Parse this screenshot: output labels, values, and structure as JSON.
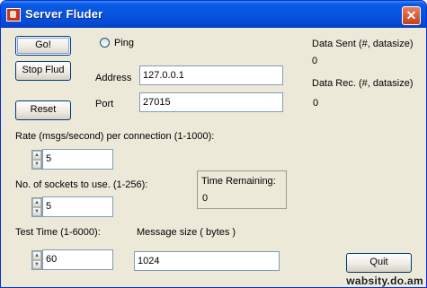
{
  "window": {
    "title": "Server Fluder",
    "close_glyph": "✕"
  },
  "buttons": {
    "go": "Go!",
    "stop": "Stop Flud",
    "reset": "Reset",
    "quit": "Quit"
  },
  "ping": {
    "label": "Ping",
    "checked": false
  },
  "address": {
    "label": "Address",
    "value": "127.0.0.1"
  },
  "port": {
    "label": "Port",
    "value": "27015"
  },
  "stats": {
    "sent_label": "Data Sent (#, datasize)",
    "sent_value": "0",
    "rec_label": "Data Rec. (#, datasize)",
    "rec_value": "0"
  },
  "rate": {
    "label": "Rate (msgs/second) per connection (1-1000):",
    "value": "5"
  },
  "sockets": {
    "label": "No. of sockets to use. (1-256):",
    "value": "5"
  },
  "time_remaining": {
    "label": "Time Remaining:",
    "value": "0"
  },
  "test_time": {
    "label": "Test Time (1-6000):",
    "value": "60"
  },
  "message_size": {
    "label": "Message size ( bytes )",
    "value": "1024"
  },
  "watermark": "wabsity.do.am",
  "colors": {
    "titlebar": "#0754e0",
    "face": "#ece9d8",
    "close": "#c3401a"
  }
}
